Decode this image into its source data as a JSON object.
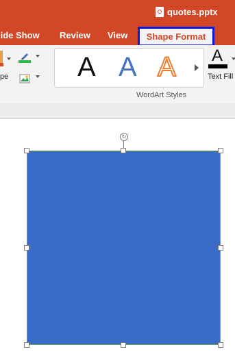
{
  "window": {
    "filename": "quotes.pptx",
    "file_icon": "powerpoint-file-icon"
  },
  "tabs": [
    {
      "label": "lide Show"
    },
    {
      "label": "Review"
    },
    {
      "label": "View"
    },
    {
      "label": "Shape Format",
      "active": true
    }
  ],
  "ribbon": {
    "left_partial_label": "pe",
    "wordart_styles": [
      "A",
      "A",
      "A"
    ],
    "wordart_group_label": "WordArt Styles",
    "text_fill": {
      "glyph": "A",
      "label": "Text Fill"
    }
  },
  "colors": {
    "accent": "#d24726",
    "highlight_border": "#1018d8",
    "shape_fill": "#3b6bc8",
    "shape_outline": "#7aaa4d"
  }
}
